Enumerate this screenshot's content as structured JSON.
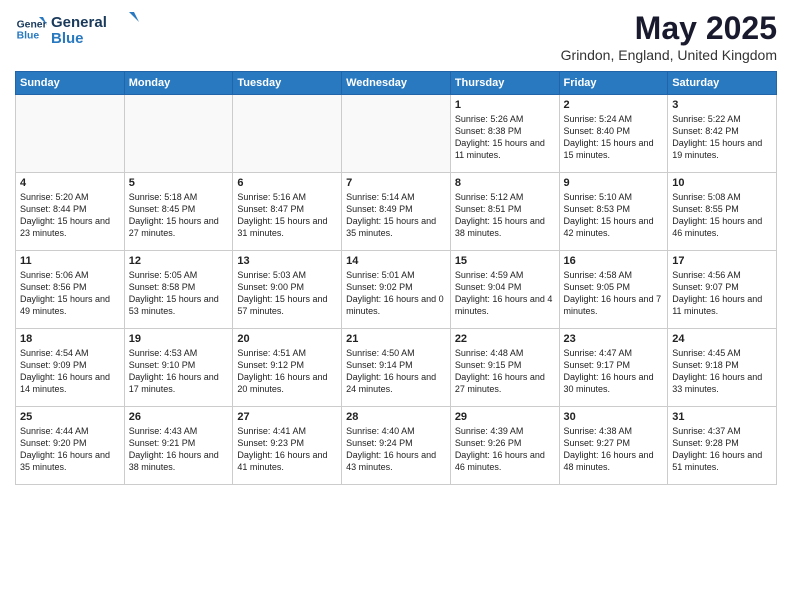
{
  "header": {
    "logo_line1": "General",
    "logo_line2": "Blue",
    "month_title": "May 2025",
    "location": "Grindon, England, United Kingdom"
  },
  "days_header": [
    "Sunday",
    "Monday",
    "Tuesday",
    "Wednesday",
    "Thursday",
    "Friday",
    "Saturday"
  ],
  "weeks": [
    [
      {
        "day": "",
        "content": ""
      },
      {
        "day": "",
        "content": ""
      },
      {
        "day": "",
        "content": ""
      },
      {
        "day": "",
        "content": ""
      },
      {
        "day": "1",
        "content": "Sunrise: 5:26 AM\nSunset: 8:38 PM\nDaylight: 15 hours\nand 11 minutes."
      },
      {
        "day": "2",
        "content": "Sunrise: 5:24 AM\nSunset: 8:40 PM\nDaylight: 15 hours\nand 15 minutes."
      },
      {
        "day": "3",
        "content": "Sunrise: 5:22 AM\nSunset: 8:42 PM\nDaylight: 15 hours\nand 19 minutes."
      }
    ],
    [
      {
        "day": "4",
        "content": "Sunrise: 5:20 AM\nSunset: 8:44 PM\nDaylight: 15 hours\nand 23 minutes."
      },
      {
        "day": "5",
        "content": "Sunrise: 5:18 AM\nSunset: 8:45 PM\nDaylight: 15 hours\nand 27 minutes."
      },
      {
        "day": "6",
        "content": "Sunrise: 5:16 AM\nSunset: 8:47 PM\nDaylight: 15 hours\nand 31 minutes."
      },
      {
        "day": "7",
        "content": "Sunrise: 5:14 AM\nSunset: 8:49 PM\nDaylight: 15 hours\nand 35 minutes."
      },
      {
        "day": "8",
        "content": "Sunrise: 5:12 AM\nSunset: 8:51 PM\nDaylight: 15 hours\nand 38 minutes."
      },
      {
        "day": "9",
        "content": "Sunrise: 5:10 AM\nSunset: 8:53 PM\nDaylight: 15 hours\nand 42 minutes."
      },
      {
        "day": "10",
        "content": "Sunrise: 5:08 AM\nSunset: 8:55 PM\nDaylight: 15 hours\nand 46 minutes."
      }
    ],
    [
      {
        "day": "11",
        "content": "Sunrise: 5:06 AM\nSunset: 8:56 PM\nDaylight: 15 hours\nand 49 minutes."
      },
      {
        "day": "12",
        "content": "Sunrise: 5:05 AM\nSunset: 8:58 PM\nDaylight: 15 hours\nand 53 minutes."
      },
      {
        "day": "13",
        "content": "Sunrise: 5:03 AM\nSunset: 9:00 PM\nDaylight: 15 hours\nand 57 minutes."
      },
      {
        "day": "14",
        "content": "Sunrise: 5:01 AM\nSunset: 9:02 PM\nDaylight: 16 hours\nand 0 minutes."
      },
      {
        "day": "15",
        "content": "Sunrise: 4:59 AM\nSunset: 9:04 PM\nDaylight: 16 hours\nand 4 minutes."
      },
      {
        "day": "16",
        "content": "Sunrise: 4:58 AM\nSunset: 9:05 PM\nDaylight: 16 hours\nand 7 minutes."
      },
      {
        "day": "17",
        "content": "Sunrise: 4:56 AM\nSunset: 9:07 PM\nDaylight: 16 hours\nand 11 minutes."
      }
    ],
    [
      {
        "day": "18",
        "content": "Sunrise: 4:54 AM\nSunset: 9:09 PM\nDaylight: 16 hours\nand 14 minutes."
      },
      {
        "day": "19",
        "content": "Sunrise: 4:53 AM\nSunset: 9:10 PM\nDaylight: 16 hours\nand 17 minutes."
      },
      {
        "day": "20",
        "content": "Sunrise: 4:51 AM\nSunset: 9:12 PM\nDaylight: 16 hours\nand 20 minutes."
      },
      {
        "day": "21",
        "content": "Sunrise: 4:50 AM\nSunset: 9:14 PM\nDaylight: 16 hours\nand 24 minutes."
      },
      {
        "day": "22",
        "content": "Sunrise: 4:48 AM\nSunset: 9:15 PM\nDaylight: 16 hours\nand 27 minutes."
      },
      {
        "day": "23",
        "content": "Sunrise: 4:47 AM\nSunset: 9:17 PM\nDaylight: 16 hours\nand 30 minutes."
      },
      {
        "day": "24",
        "content": "Sunrise: 4:45 AM\nSunset: 9:18 PM\nDaylight: 16 hours\nand 33 minutes."
      }
    ],
    [
      {
        "day": "25",
        "content": "Sunrise: 4:44 AM\nSunset: 9:20 PM\nDaylight: 16 hours\nand 35 minutes."
      },
      {
        "day": "26",
        "content": "Sunrise: 4:43 AM\nSunset: 9:21 PM\nDaylight: 16 hours\nand 38 minutes."
      },
      {
        "day": "27",
        "content": "Sunrise: 4:41 AM\nSunset: 9:23 PM\nDaylight: 16 hours\nand 41 minutes."
      },
      {
        "day": "28",
        "content": "Sunrise: 4:40 AM\nSunset: 9:24 PM\nDaylight: 16 hours\nand 43 minutes."
      },
      {
        "day": "29",
        "content": "Sunrise: 4:39 AM\nSunset: 9:26 PM\nDaylight: 16 hours\nand 46 minutes."
      },
      {
        "day": "30",
        "content": "Sunrise: 4:38 AM\nSunset: 9:27 PM\nDaylight: 16 hours\nand 48 minutes."
      },
      {
        "day": "31",
        "content": "Sunrise: 4:37 AM\nSunset: 9:28 PM\nDaylight: 16 hours\nand 51 minutes."
      }
    ]
  ]
}
